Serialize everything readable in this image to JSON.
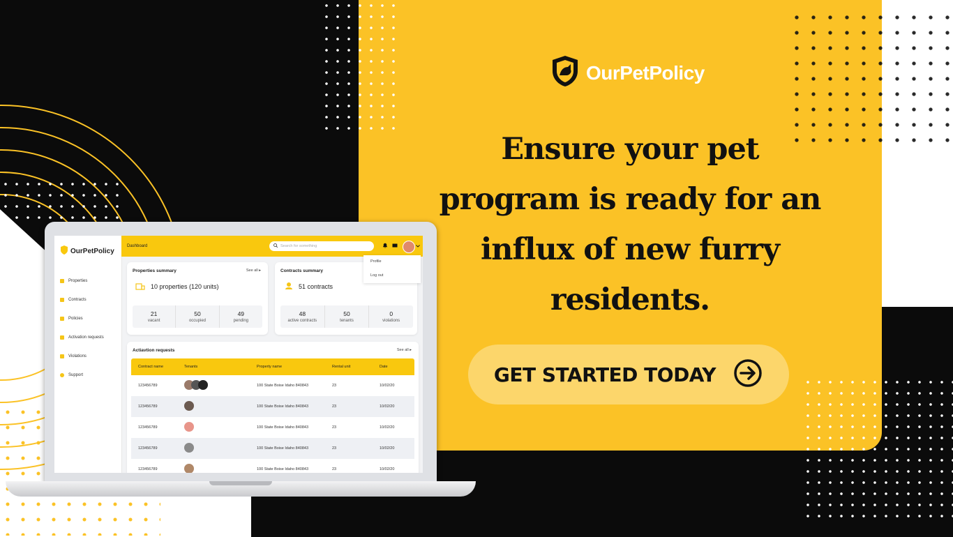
{
  "brand": {
    "name": "OurPetPolicy"
  },
  "headline": {
    "lines": [
      "Ensure your pet",
      "program is ready for an",
      "influx of new furry",
      "residents."
    ]
  },
  "cta": {
    "label": "GET STARTED TODAY",
    "icon": "arrow-right-circle-icon"
  },
  "colors": {
    "accent": "#fbc226",
    "dark": "#0b0b0b",
    "cta_bg": "#fcd66b"
  },
  "app": {
    "logo": "OurPetPolicy",
    "topbar_title": "Dashboard",
    "search_placeholder": "Search for something",
    "dropdown": {
      "profile": "Profile",
      "logout": "Log out"
    },
    "sidebar": [
      "Properties",
      "Contracts",
      "Policies",
      "Activation requests",
      "Violations",
      "Support"
    ],
    "properties_summary": {
      "title": "Properties summary",
      "see_all": "See all",
      "headline": "10 properties (120 units)",
      "stats": [
        {
          "value": "21",
          "label": "vacant"
        },
        {
          "value": "50",
          "label": "occupied"
        },
        {
          "value": "49",
          "label": "pending"
        }
      ]
    },
    "contracts_summary": {
      "title": "Contracts summary",
      "headline": "51 contracts",
      "stats": [
        {
          "value": "48",
          "label": "active contracts"
        },
        {
          "value": "50",
          "label": "tenants"
        },
        {
          "value": "0",
          "label": "violations"
        }
      ]
    },
    "activation_requests": {
      "title": "Actiavtion requests",
      "see_all": "See all",
      "columns": [
        "Contract name",
        "Tenants",
        "Property name",
        "Rental unit",
        "Date"
      ],
      "rows": [
        {
          "contract": "123456789",
          "property": "100 State Boise Idaho 840843",
          "unit": "23",
          "date": "10/02/20"
        },
        {
          "contract": "123456789",
          "property": "100 State Boise Idaho 840843",
          "unit": "23",
          "date": "10/02/20"
        },
        {
          "contract": "123456789",
          "property": "100 State Boise Idaho 840843",
          "unit": "23",
          "date": "10/02/20"
        },
        {
          "contract": "123456789",
          "property": "100 State Boise Idaho 840843",
          "unit": "23",
          "date": "10/02/20"
        },
        {
          "contract": "123456789",
          "property": "100 State Boise Idaho 840843",
          "unit": "23",
          "date": "10/02/20"
        }
      ]
    }
  }
}
